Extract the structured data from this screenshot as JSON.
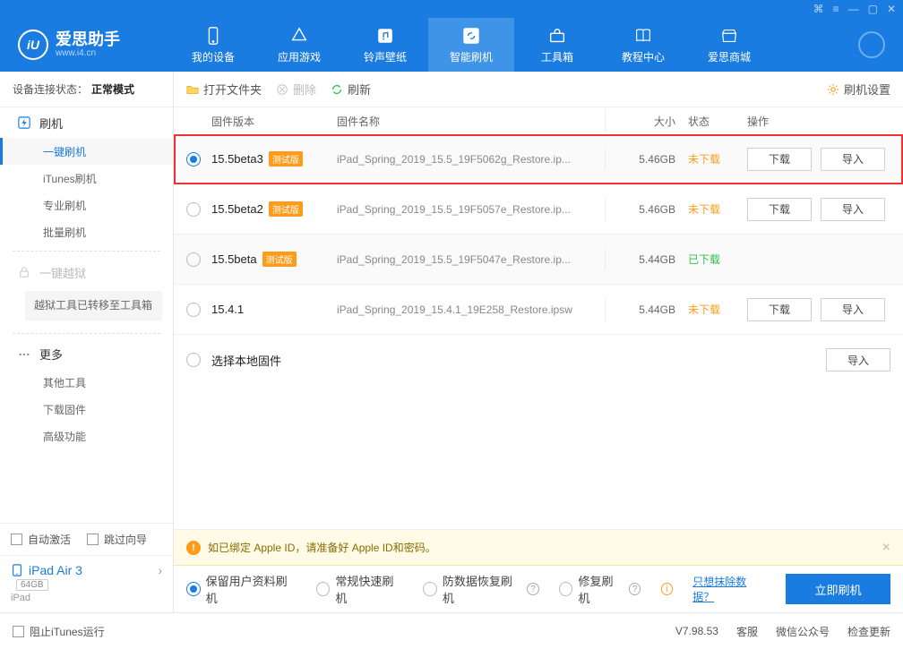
{
  "app": {
    "name": "爱思助手",
    "site": "www.i4.cn"
  },
  "nav": {
    "items": [
      {
        "label": "我的设备"
      },
      {
        "label": "应用游戏"
      },
      {
        "label": "铃声壁纸"
      },
      {
        "label": "智能刷机"
      },
      {
        "label": "工具箱"
      },
      {
        "label": "教程中心"
      },
      {
        "label": "爱思商城"
      }
    ]
  },
  "sidebar": {
    "status_label": "设备连接状态：",
    "status_value": "正常模式",
    "flash_cat": "刷机",
    "subs": [
      "一键刷机",
      "iTunes刷机",
      "专业刷机",
      "批量刷机"
    ],
    "jailbreak": "一键越狱",
    "jailbreak_note": "越狱工具已转移至工具箱",
    "more_cat": "更多",
    "more_subs": [
      "其他工具",
      "下载固件",
      "高级功能"
    ],
    "auto_activate": "自动激活",
    "skip_guide": "跳过向导",
    "device_name": "iPad Air 3",
    "device_cap": "64GB",
    "device_type": "iPad"
  },
  "toolbar": {
    "open": "打开文件夹",
    "delete": "删除",
    "refresh": "刷新",
    "settings": "刷机设置"
  },
  "columns": {
    "ver": "固件版本",
    "name": "固件名称",
    "size": "大小",
    "status": "状态",
    "ops": "操作"
  },
  "btn": {
    "download": "下载",
    "import": "导入"
  },
  "beta_tag": "测试版",
  "rows": [
    {
      "ver": "15.5beta3",
      "beta": true,
      "name": "iPad_Spring_2019_15.5_19F5062g_Restore.ip...",
      "size": "5.46GB",
      "status": "未下载",
      "status_cls": "orange",
      "sel": true,
      "dl": true,
      "imp": true
    },
    {
      "ver": "15.5beta2",
      "beta": true,
      "name": "iPad_Spring_2019_15.5_19F5057e_Restore.ip...",
      "size": "5.46GB",
      "status": "未下载",
      "status_cls": "orange",
      "sel": false,
      "dl": true,
      "imp": true
    },
    {
      "ver": "15.5beta",
      "beta": true,
      "name": "iPad_Spring_2019_15.5_19F5047e_Restore.ip...",
      "size": "5.44GB",
      "status": "已下载",
      "status_cls": "green",
      "sel": false,
      "dl": false,
      "imp": false
    },
    {
      "ver": "15.4.1",
      "beta": false,
      "name": "iPad_Spring_2019_15.4.1_19E258_Restore.ipsw",
      "size": "5.44GB",
      "status": "未下载",
      "status_cls": "orange",
      "sel": false,
      "dl": true,
      "imp": true
    }
  ],
  "local_row": "选择本地固件",
  "notice": "如已绑定 Apple ID，请准备好 Apple ID和密码。",
  "modes": {
    "keep": "保留用户资料刷机",
    "normal": "常规快速刷机",
    "anti": "防数据恢复刷机",
    "repair": "修复刷机",
    "erase_link": "只想抹除数据？",
    "flash": "立即刷机"
  },
  "footer": {
    "block_itunes": "阻止iTunes运行",
    "version": "V7.98.53",
    "service": "客服",
    "wechat": "微信公众号",
    "update": "检查更新"
  }
}
